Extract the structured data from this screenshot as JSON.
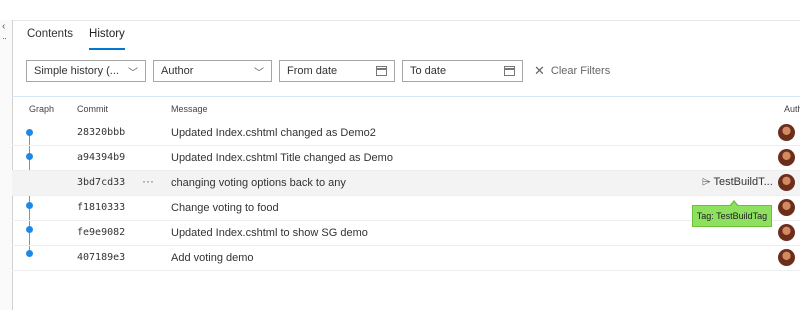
{
  "tabs": [
    {
      "label": "Contents",
      "active": false
    },
    {
      "label": "History",
      "active": true
    }
  ],
  "filters": {
    "history_mode": "Simple history (...",
    "author_placeholder": "Author",
    "from_date_placeholder": "From date",
    "to_date_placeholder": "To date",
    "clear_label": "Clear Filters"
  },
  "columns": {
    "graph": "Graph",
    "commit": "Commit",
    "message": "Message",
    "author": "Auth"
  },
  "commits": [
    {
      "sha": "28320bbb",
      "message": "Updated Index.cshtml changed as Demo2"
    },
    {
      "sha": "a94394b9",
      "message": "Updated Index.cshtml Title changed as Demo"
    },
    {
      "sha": "3bd7cd33",
      "message": "changing voting options back to any",
      "tag": "TestBuildT..."
    },
    {
      "sha": "f1810333",
      "message": "Change voting to food"
    },
    {
      "sha": "fe9e9082",
      "message": "Updated Index.cshtml to show SG demo"
    },
    {
      "sha": "407189e3",
      "message": "Add voting demo"
    }
  ],
  "more_actions": "···",
  "tooltip": "Tag: TestBuildTag",
  "colors": {
    "accent": "#0078d4",
    "graph": "#1e88e5",
    "tooltip": "#8ee05f"
  },
  "icons": [
    "collapse-chevron-icon",
    "dropdown-caret-icon",
    "calendar-icon",
    "clear-x-icon",
    "tag-icon",
    "avatar-icon"
  ]
}
